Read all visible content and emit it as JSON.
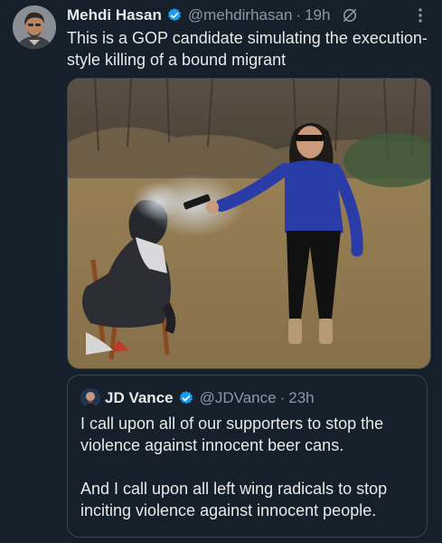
{
  "tweet": {
    "author_name": "Mehdi Hasan",
    "author_handle": "@mehdirhasan",
    "separator": "·",
    "time": "19h",
    "text": "This is a GOP candidate simulating the execution-style killing of a bound migrant"
  },
  "quote": {
    "author_name": "JD Vance",
    "author_handle": "@JDVance",
    "separator": "·",
    "time": "23h",
    "paragraph1": "I call upon all of our supporters to stop the violence against innocent beer cans.",
    "paragraph2": "And I call upon all left wing radicals to stop inciting violence against innocent people."
  },
  "colors": {
    "background": "#15202b",
    "verified": "#1d9bf0",
    "secondary_text": "#8b98a5",
    "border": "#38444d"
  },
  "icons": {
    "verified": "verified-badge-icon",
    "grok": "grok-icon",
    "more": "more-options-icon"
  }
}
